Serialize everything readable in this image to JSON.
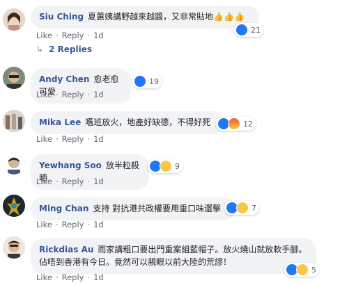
{
  "comments": [
    {
      "author": "Siu Ching",
      "text": "夏蕙姨講野越來越醬，又非常貼地",
      "trailing_emoji": "👍👍👍",
      "like": "Like",
      "reply": "Reply",
      "time": "1d",
      "reaction_count": "21",
      "reactions": [
        "like"
      ]
    },
    {
      "author": "Andy Chen",
      "text": "愈老愈可愛",
      "like": "Like",
      "reply": "Reply",
      "time": "1d",
      "reaction_count": "19",
      "reactions": [
        "like"
      ]
    },
    {
      "author": "Mika Lee",
      "text": "嚿班放火，地產好缺德，不得好死",
      "like": "Like",
      "reply": "Reply",
      "time": "1d",
      "reaction_count": "12",
      "reactions": [
        "like",
        "angry"
      ]
    },
    {
      "author": "Yewhang Soo",
      "text": "放半粒殺晒",
      "like": "Like",
      "reply": "Reply",
      "time": "1d",
      "reaction_count": "9",
      "reactions": [
        "like",
        "haha"
      ]
    },
    {
      "author": "Ming Chan",
      "text": "支持 對抗港共政權要用重口味還擊",
      "like": "Like",
      "reply": "Reply",
      "time": "1d",
      "reaction_count": "7",
      "reactions": [
        "like",
        "haha"
      ]
    },
    {
      "author": "Rickdias Au",
      "text": "而家講粗口要出門重案組藍帽子。放火燒山就放軟手腳。佔唔到香港有今日。竟然可以親眼以前大陸的荒謬！",
      "like": "Like",
      "reply": "Reply",
      "time": "1d",
      "reaction_count": "5",
      "reactions": [
        "like",
        "sad"
      ]
    }
  ],
  "replies_link": "2 Replies",
  "colors": {
    "author": "#385898",
    "bubble": "#f2f3f5",
    "like_blue": "#2078f4"
  }
}
